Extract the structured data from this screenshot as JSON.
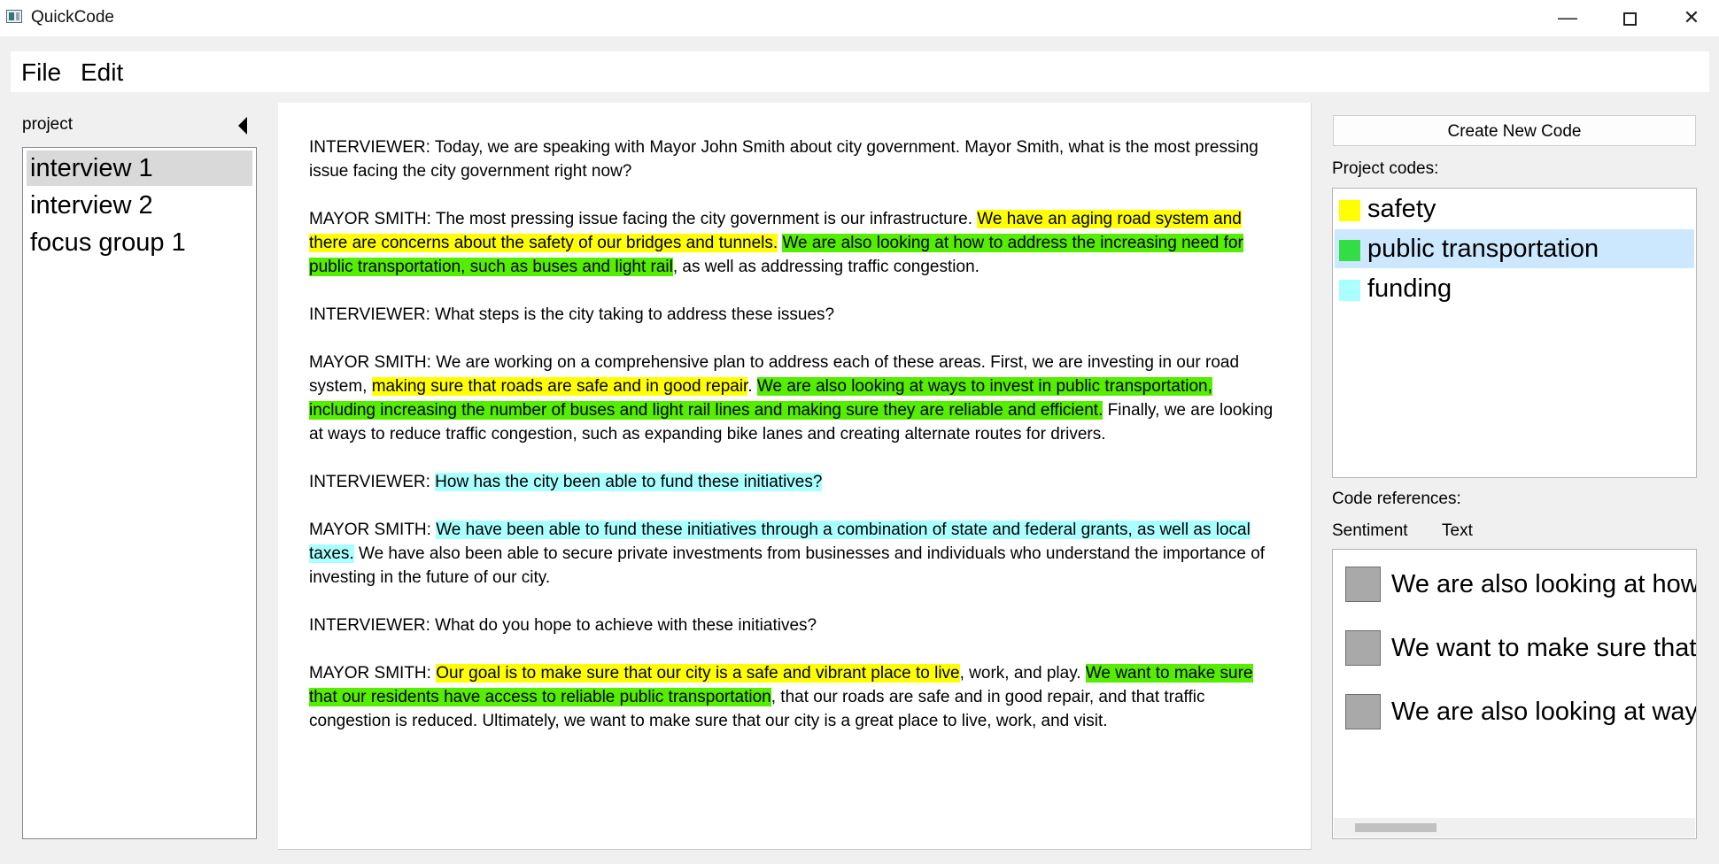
{
  "window": {
    "title": "QuickCode",
    "controls": {
      "minimize": "—",
      "close": "✕"
    }
  },
  "menu": [
    "File",
    "Edit"
  ],
  "project": {
    "label": "project",
    "items": [
      {
        "label": "interview 1",
        "selected": true
      },
      {
        "label": "interview 2",
        "selected": false
      },
      {
        "label": "focus group 1",
        "selected": false
      }
    ]
  },
  "document": {
    "paragraphs": [
      [
        {
          "text": "INTERVIEWER: Today, we are speaking with Mayor John Smith about city government. Mayor Smith, what is the most pressing issue facing the city government right now?",
          "code": ""
        }
      ],
      [
        {
          "text": "MAYOR SMITH: The most pressing issue facing the city government is our infrastructure. ",
          "code": ""
        },
        {
          "text": "We have an aging road system and there are concerns about the safety of our bridges and tunnels.",
          "code": "safety"
        },
        {
          "text": " ",
          "code": ""
        },
        {
          "text": "We are also looking at how to address the increasing need for public transportation, such as buses and light rail",
          "code": "public transportation"
        },
        {
          "text": ", as well as addressing traffic congestion.",
          "code": ""
        }
      ],
      [
        {
          "text": "INTERVIEWER: What steps is the city taking to address these issues?",
          "code": ""
        }
      ],
      [
        {
          "text": "MAYOR SMITH: We are working on a comprehensive plan to address each of these areas. First, we are investing in our road system, ",
          "code": ""
        },
        {
          "text": "making sure that roads are safe and in good repair",
          "code": "safety"
        },
        {
          "text": ". ",
          "code": ""
        },
        {
          "text": "We are also looking at ways to invest in public transportation, including increasing the number of buses and light rail lines and making sure they are reliable and efficient.",
          "code": "public transportation"
        },
        {
          "text": " Finally, we are looking at ways to reduce traffic congestion, such as expanding bike lanes and creating alternate routes for drivers.",
          "code": ""
        }
      ],
      [
        {
          "text": "INTERVIEWER: ",
          "code": ""
        },
        {
          "text": "How has the city been able to fund these initiatives?",
          "code": "funding"
        }
      ],
      [
        {
          "text": "MAYOR SMITH: ",
          "code": ""
        },
        {
          "text": "We have been able to fund these initiatives through a combination of state and federal grants, as well as local taxes.",
          "code": "funding"
        },
        {
          "text": " We have also been able to secure private investments from businesses and individuals who understand the importance of investing in the future of our city.",
          "code": ""
        }
      ],
      [
        {
          "text": "INTERVIEWER: What do you hope to achieve with these initiatives?",
          "code": ""
        }
      ],
      [
        {
          "text": "MAYOR SMITH: ",
          "code": ""
        },
        {
          "text": "Our goal is to make sure that our city is a safe and vibrant place to live",
          "code": "safety"
        },
        {
          "text": ", work, and play. ",
          "code": ""
        },
        {
          "text": "We want to make sure that our residents have access to reliable public transportation",
          "code": "public transportation"
        },
        {
          "text": ", that our roads are safe and in good repair, and that traffic congestion is reduced. Ultimately, we want to make sure that our city is a great place to live, work, and visit.",
          "code": ""
        }
      ]
    ]
  },
  "codes_panel": {
    "create_button": "Create New Code",
    "label": "Project codes:",
    "codes": [
      {
        "name": "safety",
        "color": "#ffff00",
        "highlight": "#ffff00",
        "selected": false
      },
      {
        "name": "public transportation",
        "color": "#33dd44",
        "highlight": "#55ee00",
        "selected": true
      },
      {
        "name": "funding",
        "color": "#aaffff",
        "highlight": "#aaffff",
        "selected": false
      }
    ]
  },
  "references_panel": {
    "label": "Code references:",
    "columns": [
      "Sentiment",
      "Text"
    ],
    "rows": [
      {
        "text": "We are also looking at how"
      },
      {
        "text": "We want to make sure that"
      },
      {
        "text": "We are also looking at ways"
      }
    ]
  }
}
